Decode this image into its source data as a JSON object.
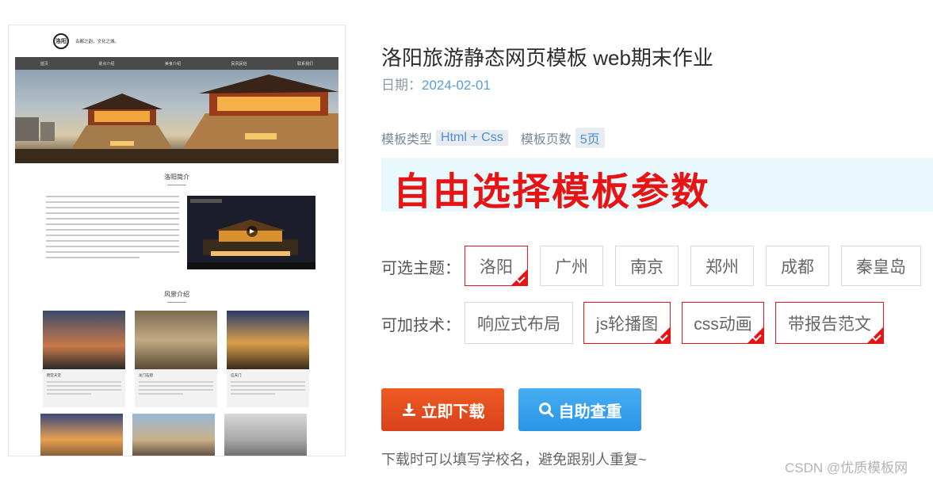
{
  "preview": {
    "logo_text": "洛阳",
    "slogan": "古都之韵，文化之城。",
    "nav": [
      "首页",
      "景点介绍",
      "美食介绍",
      "民风民俗",
      "联系我们"
    ],
    "section1_title": "洛阳简介",
    "section2_title": "风景介绍",
    "cards": [
      {
        "title": "明堂天堂"
      },
      {
        "title": "龙门石窟"
      },
      {
        "title": "应天门"
      }
    ]
  },
  "info": {
    "title": "洛阳旅游静态网页模板 web期末作业",
    "date_label": "日期：",
    "date_value": "2024-02-01",
    "type_label": "模板类型",
    "type_value": "Html + Css",
    "pages_label": "模板页数",
    "pages_value": "5页"
  },
  "banner": {
    "text": "自由选择模板参数"
  },
  "themes": {
    "label": "可选主题：",
    "options": [
      {
        "label": "洛阳",
        "selected": true
      },
      {
        "label": "广州",
        "selected": false
      },
      {
        "label": "南京",
        "selected": false
      },
      {
        "label": "郑州",
        "selected": false
      },
      {
        "label": "成都",
        "selected": false
      },
      {
        "label": "秦皇岛",
        "selected": false
      }
    ]
  },
  "tech": {
    "label": "可加技术：",
    "options": [
      {
        "label": "响应式布局",
        "selected": false
      },
      {
        "label": "js轮播图",
        "selected": true
      },
      {
        "label": "css动画",
        "selected": true
      },
      {
        "label": "带报告范文",
        "selected": true
      }
    ]
  },
  "buttons": {
    "download": "立即下载",
    "check": "自助查重"
  },
  "icons": {
    "download": "download-icon",
    "check": "search-icon"
  },
  "colors": {
    "accent_red": "#e61414",
    "download_btn": "#e04b1f",
    "check_btn": "#3aa3ee"
  },
  "note": "下载时可以填写学校名，避免跟别人重复~",
  "watermark": "CSDN @优质模板网"
}
